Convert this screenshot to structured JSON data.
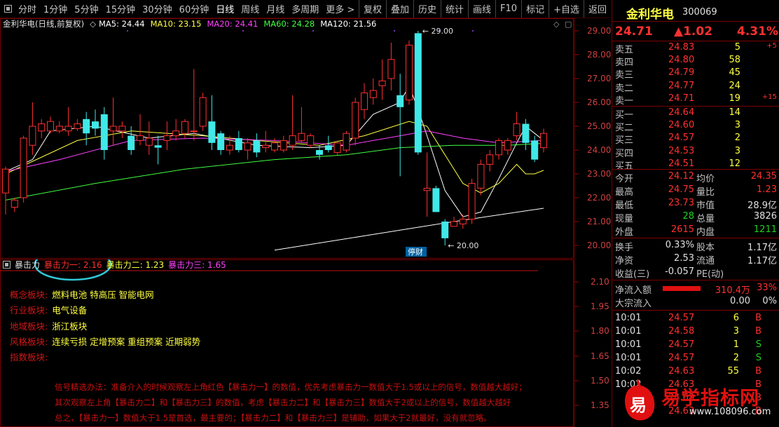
{
  "toolbar": {
    "periods": [
      "分时",
      "1分钟",
      "5分钟",
      "15分钟",
      "30分钟",
      "60分钟",
      "日线",
      "周线",
      "月线",
      "多周期",
      "更多 >"
    ],
    "active": "日线",
    "buttons": [
      "复权",
      "叠加",
      "历史",
      "统计",
      "画线",
      "F10",
      "标记",
      "+自选",
      "返回"
    ]
  },
  "chart": {
    "title": "金利华电(日线,前复权)",
    "ma": [
      {
        "label": "MA5: 24.44",
        "color": "#ffffff"
      },
      {
        "label": "MA10: 23.15",
        "color": "#ffff40"
      },
      {
        "label": "MA20: 24.41",
        "color": "#ff40ff"
      },
      {
        "label": "MA60: 24.28",
        "color": "#40ff40"
      },
      {
        "label": "MA120: 21.56",
        "color": "#ffffff"
      }
    ],
    "price_axis": [
      "29.00",
      "28.00",
      "27.00",
      "26.00",
      "25.00",
      "24.00",
      "23.00",
      "22.00",
      "21.00",
      "20.00"
    ],
    "high_note": "29.00",
    "low_note": "20.00",
    "badge": "停财"
  },
  "chart_data": {
    "type": "candlestick",
    "ylim": [
      19.6,
      29.5
    ],
    "candles": [
      [
        22.2,
        23.2,
        21.3,
        23.3
      ],
      [
        21.6,
        21.9,
        21.4,
        22.0
      ],
      [
        22.0,
        24.5,
        21.8,
        24.6
      ],
      [
        24.2,
        25.0,
        23.8,
        26.0
      ],
      [
        24.8,
        25.1,
        24.5,
        25.3
      ],
      [
        24.8,
        25.2,
        24.7,
        25.4
      ],
      [
        24.8,
        25.0,
        24.7,
        25.2
      ],
      [
        24.8,
        25.0,
        24.6,
        25.8
      ],
      [
        24.9,
        25.1,
        24.8,
        25.3
      ],
      [
        25.3,
        24.7,
        24.2,
        25.6
      ],
      [
        25.2,
        24.9,
        24.6,
        25.7
      ],
      [
        25.5,
        24.0,
        23.6,
        25.8
      ],
      [
        24.8,
        25.0,
        24.2,
        26.2
      ],
      [
        24.8,
        25.0,
        24.5,
        25.2
      ],
      [
        24.6,
        24.0,
        23.8,
        25.0
      ],
      [
        24.4,
        24.6,
        24.2,
        25.5
      ],
      [
        24.2,
        24.5,
        23.8,
        25.2
      ],
      [
        24.2,
        24.1,
        23.4,
        24.6
      ],
      [
        24.4,
        24.6,
        24.0,
        25.2
      ],
      [
        24.6,
        24.8,
        24.4,
        25.3
      ],
      [
        24.7,
        25.2,
        24.5,
        25.3
      ],
      [
        24.8,
        24.8,
        24.4,
        27.4
      ],
      [
        25.0,
        26.2,
        24.8,
        26.4
      ],
      [
        25.2,
        24.3,
        24.0,
        26.3
      ],
      [
        24.7,
        24.0,
        23.8,
        24.8
      ],
      [
        24.0,
        24.2,
        23.8,
        24.6
      ],
      [
        24.5,
        24.0,
        23.9,
        24.8
      ],
      [
        24.0,
        24.3,
        23.6,
        24.5
      ],
      [
        24.4,
        23.9,
        23.7,
        24.7
      ],
      [
        24.1,
        24.2,
        23.9,
        24.8
      ],
      [
        24.0,
        24.3,
        23.9,
        24.5
      ],
      [
        24.0,
        24.4,
        23.9,
        24.6
      ],
      [
        24.2,
        24.6,
        24.0,
        26.3
      ],
      [
        24.4,
        24.7,
        24.3,
        25.8
      ],
      [
        24.2,
        24.6,
        24.1,
        24.7
      ],
      [
        24.0,
        23.8,
        23.6,
        24.2
      ],
      [
        24.2,
        24.0,
        23.9,
        24.6
      ],
      [
        23.9,
        24.3,
        23.8,
        24.4
      ],
      [
        24.0,
        24.7,
        23.9,
        24.8
      ],
      [
        24.5,
        26.0,
        24.2,
        26.2
      ],
      [
        25.7,
        26.4,
        25.3,
        26.8
      ],
      [
        26.2,
        26.5,
        25.9,
        27.0
      ],
      [
        26.7,
        26.9,
        26.1,
        27.8
      ],
      [
        27.0,
        27.8,
        26.5,
        28.5
      ],
      [
        26.3,
        25.8,
        22.9,
        27.2
      ],
      [
        26.1,
        28.4,
        25.9,
        28.6
      ],
      [
        28.9,
        23.9,
        23.8,
        29.0
      ],
      [
        22.3,
        22.4,
        21.2,
        23.9
      ],
      [
        22.4,
        21.4,
        21.4,
        22.5
      ],
      [
        21.0,
        20.3,
        20.0,
        21.1
      ],
      [
        20.8,
        21.0,
        20.8,
        21.2
      ],
      [
        20.9,
        21.1,
        20.7,
        21.3
      ],
      [
        21.1,
        22.6,
        20.9,
        22.8
      ],
      [
        22.4,
        23.4,
        22.1,
        23.6
      ],
      [
        23.4,
        23.8,
        23.1,
        24.0
      ],
      [
        23.8,
        24.4,
        23.6,
        24.5
      ],
      [
        24.0,
        24.4,
        23.8,
        24.5
      ],
      [
        24.6,
        25.1,
        24.4,
        25.6
      ],
      [
        25.1,
        24.3,
        24.0,
        25.3
      ],
      [
        24.4,
        23.6,
        23.5,
        24.6
      ],
      [
        24.1,
        24.7,
        23.9,
        24.9
      ]
    ],
    "ma_series": [
      {
        "name": "MA5",
        "color": "#ffffff",
        "points": [
          [
            0,
            23.1
          ],
          [
            3,
            23.6
          ],
          [
            5,
            24.8
          ],
          [
            10,
            25.0
          ],
          [
            16,
            24.5
          ],
          [
            21,
            24.7
          ],
          [
            28,
            24.2
          ],
          [
            34,
            24.1
          ],
          [
            38,
            24.2
          ],
          [
            41,
            25.5
          ],
          [
            44,
            26.0
          ],
          [
            45,
            26.7
          ],
          [
            46,
            25.7
          ],
          [
            47,
            24.6
          ],
          [
            49,
            22.3
          ],
          [
            51,
            21.2
          ],
          [
            53,
            21.4
          ],
          [
            55,
            22.8
          ],
          [
            57,
            24.3
          ],
          [
            58,
            25.0
          ],
          [
            59,
            24.7
          ],
          [
            60,
            24.4
          ]
        ]
      },
      {
        "name": "MA10",
        "color": "#ffff40",
        "points": [
          [
            0,
            23.0
          ],
          [
            8,
            24.4
          ],
          [
            14,
            24.8
          ],
          [
            22,
            24.6
          ],
          [
            28,
            24.4
          ],
          [
            35,
            24.2
          ],
          [
            40,
            24.6
          ],
          [
            45,
            25.2
          ],
          [
            47,
            25.0
          ],
          [
            49,
            23.8
          ],
          [
            51,
            22.6
          ],
          [
            53,
            22.2
          ],
          [
            55,
            22.6
          ],
          [
            57,
            23.4
          ],
          [
            58,
            23.0
          ],
          [
            59,
            23.0
          ],
          [
            60,
            23.15
          ]
        ]
      },
      {
        "name": "MA20",
        "color": "#ff40ff",
        "points": [
          [
            0,
            23.1
          ],
          [
            6,
            23.6
          ],
          [
            14,
            24.4
          ],
          [
            22,
            24.5
          ],
          [
            30,
            24.4
          ],
          [
            38,
            24.2
          ],
          [
            44,
            24.6
          ],
          [
            47,
            24.8
          ],
          [
            51,
            24.5
          ],
          [
            55,
            24.3
          ],
          [
            60,
            24.41
          ]
        ]
      },
      {
        "name": "MA60",
        "color": "#40ff40",
        "points": [
          [
            0,
            21.9
          ],
          [
            10,
            22.6
          ],
          [
            20,
            23.2
          ],
          [
            30,
            23.6
          ],
          [
            38,
            23.8
          ],
          [
            44,
            24.1
          ],
          [
            50,
            24.2
          ],
          [
            56,
            24.2
          ],
          [
            60,
            24.28
          ]
        ]
      },
      {
        "name": "MA120",
        "color": "#ffffff",
        "points": [
          [
            30,
            19.8
          ],
          [
            40,
            20.4
          ],
          [
            50,
            21.0
          ],
          [
            60,
            21.56
          ]
        ]
      }
    ]
  },
  "indicator": {
    "name": "暴击力",
    "items": [
      {
        "label": "暴击力一: 2.16",
        "color": "#ff3030"
      },
      {
        "label": "暴击力二: 1.23",
        "color": "#ffff40"
      },
      {
        "label": "暴击力三: 1.65",
        "color": "#ff40ff"
      }
    ],
    "axis": [
      "2.10",
      "1.95",
      "1.80",
      "1.65",
      "1.50",
      "1.35"
    ]
  },
  "info": {
    "rows": [
      {
        "label": "概念板块:",
        "value": "燃料电池 特高压 智能电网"
      },
      {
        "label": "行业板块:",
        "value": "电气设备"
      },
      {
        "label": "地域板块:",
        "value": "浙江板块"
      },
      {
        "label": "风格板块:",
        "value": "连续亏损 定增预案 重组预案 近期弱势"
      },
      {
        "label": "指数板块:",
        "value": ""
      }
    ],
    "signal_lines": [
      "信号精选办法：准备介入的时候观察左上角红色【暴击力一】的数值，优先考虑暴击力一数值大于1.5或以上的信号，数值越大越好；",
      "其次观察左上角【暴击力二】和【暴击力三】的数值，考虑【暴击力二】和【暴击力三】数值大于2或以上的信号，数值越大越好",
      "总之，【暴击力一】数值大于1.5是首选，最主要的；【暴击力二】和【暴击力三】是辅助，如果大于2就最好，没有就忽略。"
    ]
  },
  "quote": {
    "name": "金利华电",
    "code": "300069",
    "price": "24.71",
    "change": "▲1.02",
    "pct": "4.31%",
    "sell": [
      {
        "label": "卖五",
        "price": "24.83",
        "vol": "5",
        "chg": "+5"
      },
      {
        "label": "卖四",
        "price": "24.80",
        "vol": "58",
        "chg": ""
      },
      {
        "label": "卖三",
        "price": "24.79",
        "vol": "45",
        "chg": ""
      },
      {
        "label": "卖二",
        "price": "24.77",
        "vol": "24",
        "chg": ""
      },
      {
        "label": "卖一",
        "price": "24.71",
        "vol": "19",
        "chg": "+15"
      }
    ],
    "buy": [
      {
        "label": "买一",
        "price": "24.64",
        "vol": "14"
      },
      {
        "label": "买二",
        "price": "24.60",
        "vol": "3"
      },
      {
        "label": "买三",
        "price": "24.57",
        "vol": "2"
      },
      {
        "label": "买四",
        "price": "24.53",
        "vol": "3"
      },
      {
        "label": "买五",
        "price": "24.51",
        "vol": "12"
      }
    ],
    "stats": [
      {
        "l1": "今开",
        "v1": "24.12",
        "c1": "red",
        "l2": "均价",
        "v2": "24.35",
        "c2": "red"
      },
      {
        "l1": "最高",
        "v1": "24.75",
        "c1": "red",
        "l2": "量比",
        "v2": "1.23",
        "c2": "red"
      },
      {
        "l1": "最低",
        "v1": "23.73",
        "c1": "red",
        "l2": "市值",
        "v2": "28.9亿",
        "c2": "wht"
      },
      {
        "l1": "现量",
        "v1": "28",
        "c1": "grn",
        "l2": "总量",
        "v2": "3826",
        "c2": "wht"
      },
      {
        "l1": "外盘",
        "v1": "2615",
        "c1": "red",
        "l2": "内盘",
        "v2": "1211",
        "c2": "grn"
      }
    ],
    "stats2": [
      {
        "l1": "换手",
        "v1": "0.33%",
        "l2": "股本",
        "v2": "1.17亿"
      },
      {
        "l1": "净资",
        "v1": "2.53",
        "l2": "流通",
        "v2": "1.17亿"
      },
      {
        "l1": "收益(三)",
        "v1": "-0.057",
        "l2": "PE(动)",
        "v2": ""
      }
    ],
    "flow": [
      {
        "label": "净流入额",
        "value": "310.4万",
        "pct": "33%"
      },
      {
        "label": "大宗流入",
        "value": "0.00",
        "pct": "0%"
      }
    ],
    "ticks": [
      {
        "time": "10:01",
        "price": "24.57",
        "vol": "6",
        "bs": "B"
      },
      {
        "time": "10:01",
        "price": "24.58",
        "vol": "3",
        "bs": "B"
      },
      {
        "time": "10:01",
        "price": "24.57",
        "vol": "1",
        "bs": "S"
      },
      {
        "time": "10:01",
        "price": "24.57",
        "vol": "2",
        "bs": "S"
      },
      {
        "time": "10:02",
        "price": "24.63",
        "vol": "55",
        "bs": "B"
      },
      {
        "time": "10:02",
        "price": "24.63",
        "vol": "",
        "bs": "B"
      },
      {
        "time": "",
        "price": "24.63",
        "vol": "",
        "bs": "B"
      },
      {
        "time": "",
        "price": "24.63",
        "vol": "",
        "bs": "B"
      }
    ]
  },
  "watermark": {
    "char": "易",
    "title": "易学指标网",
    "url": "www.108096.com"
  },
  "ui": {
    "settings_icon_glyph": "◇",
    "expand_icon_glyph": "▢",
    "dropdown_glyph": "˅"
  }
}
